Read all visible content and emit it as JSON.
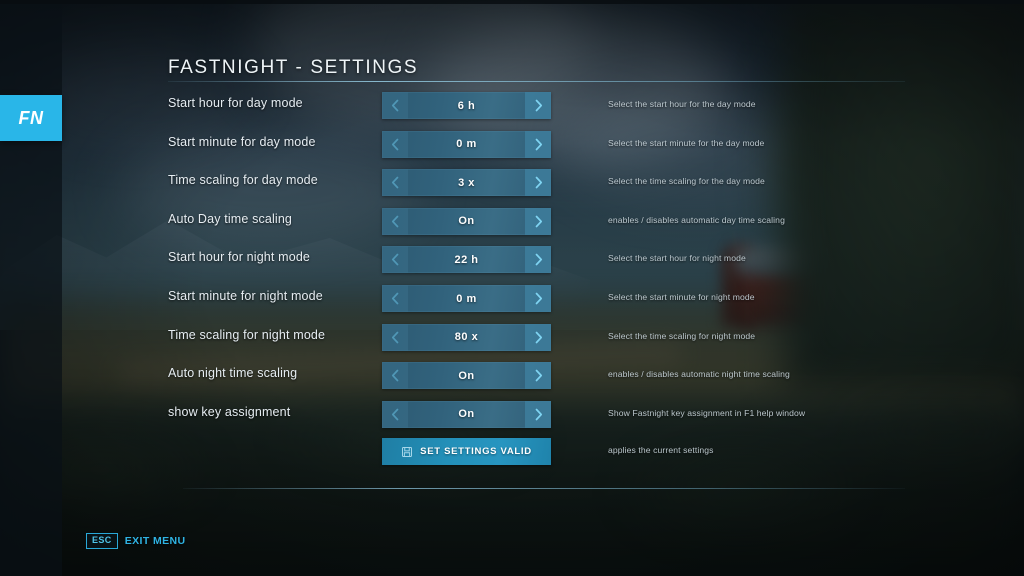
{
  "logo": {
    "text": "FN",
    "accent": "#29b6e8"
  },
  "header": {
    "title": "FASTNIGHT - SETTINGS"
  },
  "theme": {
    "accent": "#29b6e8",
    "selector_bg": "#33657f",
    "action_bg": "#2390b9",
    "label_color": "#e6edf2",
    "desc_color": "#c8d4da"
  },
  "settings": [
    {
      "label": "Start hour for day mode",
      "value": "6 h",
      "description": "Select the start hour for the day mode",
      "prev_icon": "chevron-left-icon",
      "next_icon": "chevron-right-icon"
    },
    {
      "label": "Start minute for day mode",
      "value": "0 m",
      "description": "Select the start minute for the day mode",
      "prev_icon": "chevron-left-icon",
      "next_icon": "chevron-right-icon"
    },
    {
      "label": "Time scaling for day mode",
      "value": "3 x",
      "description": "Select the time scaling for the day mode",
      "prev_icon": "chevron-left-icon",
      "next_icon": "chevron-right-icon"
    },
    {
      "label": "Auto Day time scaling",
      "value": "On",
      "description": "enables / disables automatic day time scaling",
      "prev_icon": "chevron-left-icon",
      "next_icon": "chevron-right-icon"
    },
    {
      "label": "Start hour for night mode",
      "value": "22 h",
      "description": "Select the start hour for night mode",
      "prev_icon": "chevron-left-icon",
      "next_icon": "chevron-right-icon"
    },
    {
      "label": "Start minute for night mode",
      "value": "0 m",
      "description": "Select the start minute for night mode",
      "prev_icon": "chevron-left-icon",
      "next_icon": "chevron-right-icon"
    },
    {
      "label": "Time scaling for night mode",
      "value": "80 x",
      "description": "Select the time scaling for night mode",
      "prev_icon": "chevron-left-icon",
      "next_icon": "chevron-right-icon"
    },
    {
      "label": "Auto night time scaling",
      "value": "On",
      "description": "enables / disables automatic night time scaling",
      "prev_icon": "chevron-left-icon",
      "next_icon": "chevron-right-icon"
    },
    {
      "label": "show key assignment",
      "value": "On",
      "description": "Show Fastnight key assignment in F1 help window",
      "prev_icon": "chevron-left-icon",
      "next_icon": "chevron-right-icon"
    }
  ],
  "action": {
    "label": "SET SETTINGS VALID",
    "icon": "save-disk-icon",
    "description": "applies the current settings"
  },
  "footer": {
    "key": "ESC",
    "label": "EXIT MENU"
  }
}
